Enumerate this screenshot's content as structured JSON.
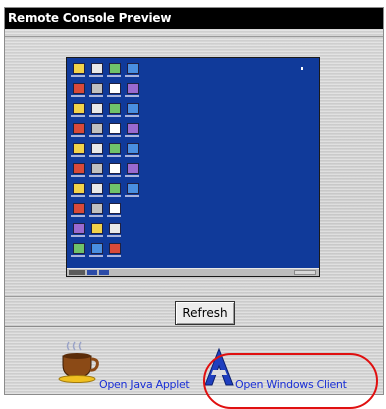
{
  "panel": {
    "title": "Remote Console Preview"
  },
  "preview": {
    "desktop_color": "#103a9a",
    "icon_rows": 10,
    "icon_cols": 4
  },
  "actions": {
    "refresh_label": "Refresh",
    "java_applet_label": "Open Java Applet",
    "windows_client_label": "Open Windows Client"
  },
  "colors": {
    "title_bar": "#000000",
    "link": "#1a2fd6",
    "highlight": "#e01010"
  }
}
